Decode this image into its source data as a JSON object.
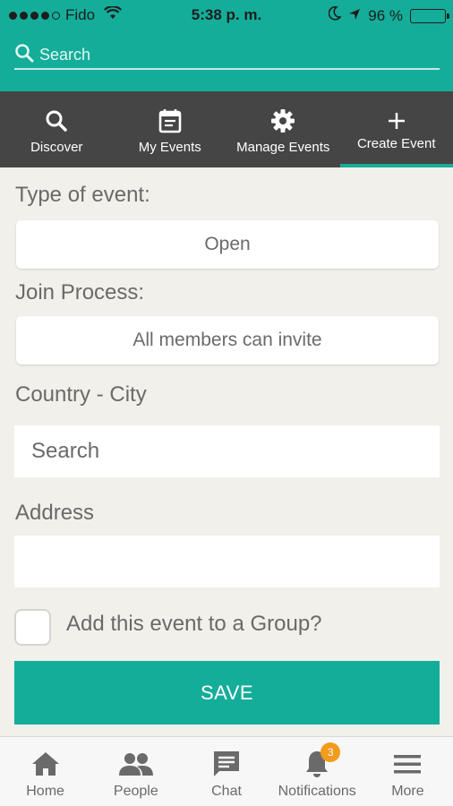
{
  "status_bar": {
    "carrier": "Fido",
    "time": "5:38 p. m.",
    "battery": "96 %",
    "battery_level": 0.96,
    "signal_bars": 4
  },
  "search": {
    "placeholder": "Search"
  },
  "tabs": [
    {
      "label": "Discover",
      "icon": "search-icon"
    },
    {
      "label": "My Events",
      "icon": "calendar-icon"
    },
    {
      "label": "Manage Events",
      "icon": "gear-icon"
    },
    {
      "label": "Create Event",
      "icon": "plus-icon",
      "active": true
    }
  ],
  "form": {
    "type_label": "Type of event:",
    "type_value": "Open",
    "join_label": "Join Process:",
    "join_value": "All members can invite",
    "country_label": "Country - City",
    "country_placeholder": "Search",
    "address_label": "Address",
    "address_value": "",
    "group_checkbox_label": "Add this event to a Group?",
    "group_checked": false,
    "save_label": "SAVE"
  },
  "bottom_nav": [
    {
      "label": "Home",
      "icon": "home-icon"
    },
    {
      "label": "People",
      "icon": "people-icon"
    },
    {
      "label": "Chat",
      "icon": "chat-icon"
    },
    {
      "label": "Notifications",
      "icon": "bell-icon",
      "badge": "3"
    },
    {
      "label": "More",
      "icon": "menu-icon"
    }
  ],
  "colors": {
    "accent": "#14ad99",
    "tab_bar": "#454545",
    "background": "#f2f0eb",
    "badge": "#f39b1c"
  }
}
